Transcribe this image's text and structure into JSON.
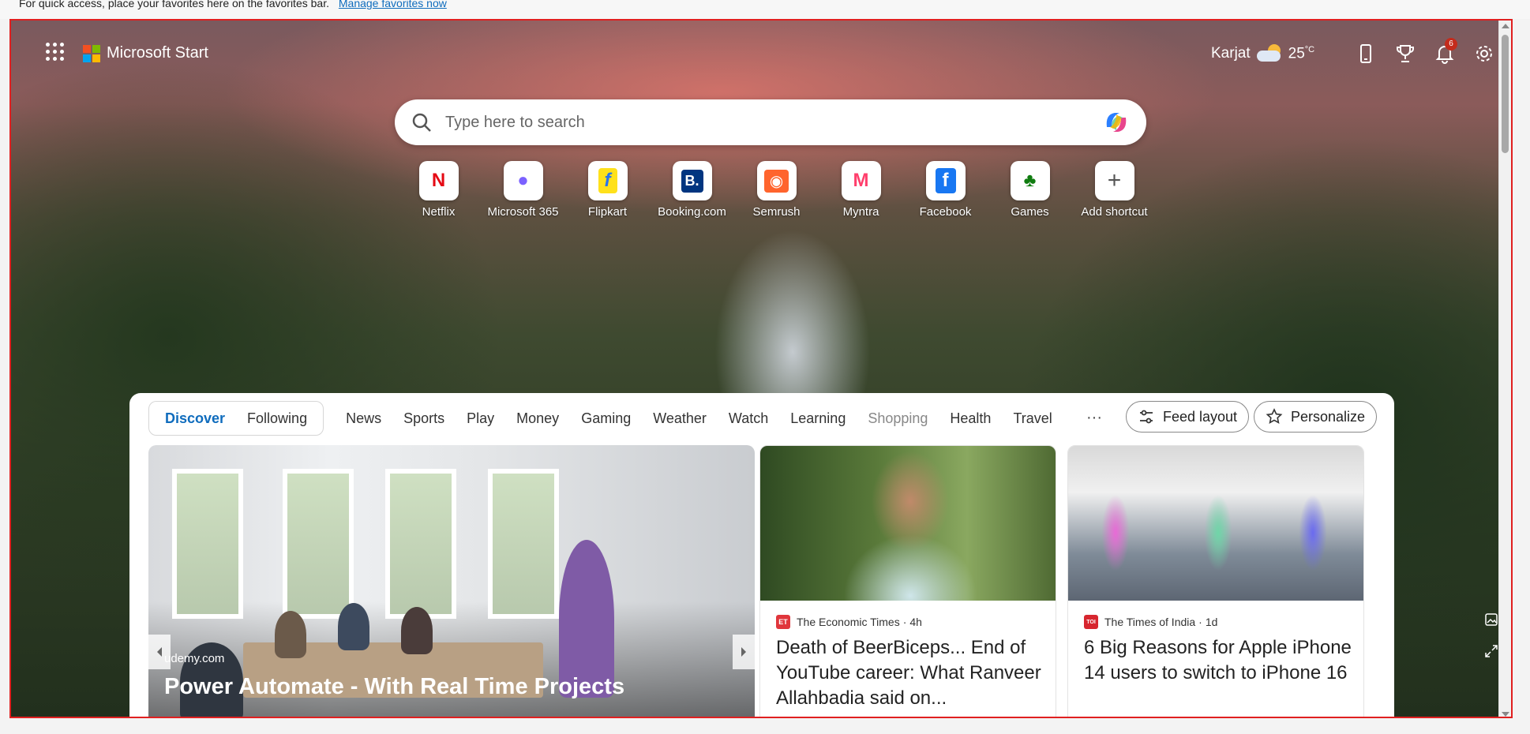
{
  "favorites_bar": {
    "message": "For quick access, place your favorites here on the favorites bar.",
    "link": "Manage favorites now"
  },
  "header": {
    "brand": "Microsoft Start",
    "location": "Karjat",
    "temperature": "25",
    "temp_unit": "°C",
    "notification_count": "6",
    "icons": [
      "apps-icon",
      "weather-partly-cloudy-icon",
      "phone-icon",
      "trophy-icon",
      "bell-icon",
      "gear-icon"
    ]
  },
  "search": {
    "placeholder": "Type here to search"
  },
  "shortcuts": [
    {
      "label": "Netflix",
      "icon": "netflix-icon",
      "glyph": "N",
      "color": "#e50914"
    },
    {
      "label": "Microsoft 365",
      "icon": "microsoft-365-icon",
      "glyph": "●",
      "color": "#7b61ff"
    },
    {
      "label": "Flipkart",
      "icon": "flipkart-icon",
      "glyph": "f",
      "color": "#2874f0"
    },
    {
      "label": "Booking.com",
      "icon": "booking-icon",
      "glyph": "B.",
      "color": "#003580"
    },
    {
      "label": "Semrush",
      "icon": "semrush-icon",
      "glyph": "◉",
      "color": "#ff642d"
    },
    {
      "label": "Myntra",
      "icon": "myntra-icon",
      "glyph": "M",
      "color": "#ff3f6c"
    },
    {
      "label": "Facebook",
      "icon": "facebook-icon",
      "glyph": "f",
      "color": "#1877f2"
    },
    {
      "label": "Games",
      "icon": "games-icon",
      "glyph": "♣",
      "color": "#107c10"
    },
    {
      "label": "Add shortcut",
      "icon": "plus-icon",
      "glyph": "+",
      "color": "#555555"
    }
  ],
  "feed": {
    "tabs_primary": [
      "Discover",
      "Following"
    ],
    "tabs": [
      "News",
      "Sports",
      "Play",
      "Money",
      "Gaming",
      "Weather",
      "Watch",
      "Learning",
      "Shopping",
      "Health",
      "Travel"
    ],
    "more": "···",
    "feed_layout": "Feed layout",
    "personalize": "Personalize",
    "hero": {
      "source": "udemy.com",
      "title": "Power Automate - With Real Time Projects"
    },
    "cards": [
      {
        "source": "The Economic Times",
        "age": "4h",
        "logo": "ET",
        "logo_color": "#e0363c",
        "headline": "Death of BeerBiceps... End of YouTube career: What Ranveer Allahbadia said on..."
      },
      {
        "source": "The Times of India",
        "age": "1d",
        "logo": "TOI",
        "logo_color": "#d7262f",
        "headline": "6 Big Reasons for Apple iPhone 14 users to switch to iPhone 16"
      }
    ]
  }
}
